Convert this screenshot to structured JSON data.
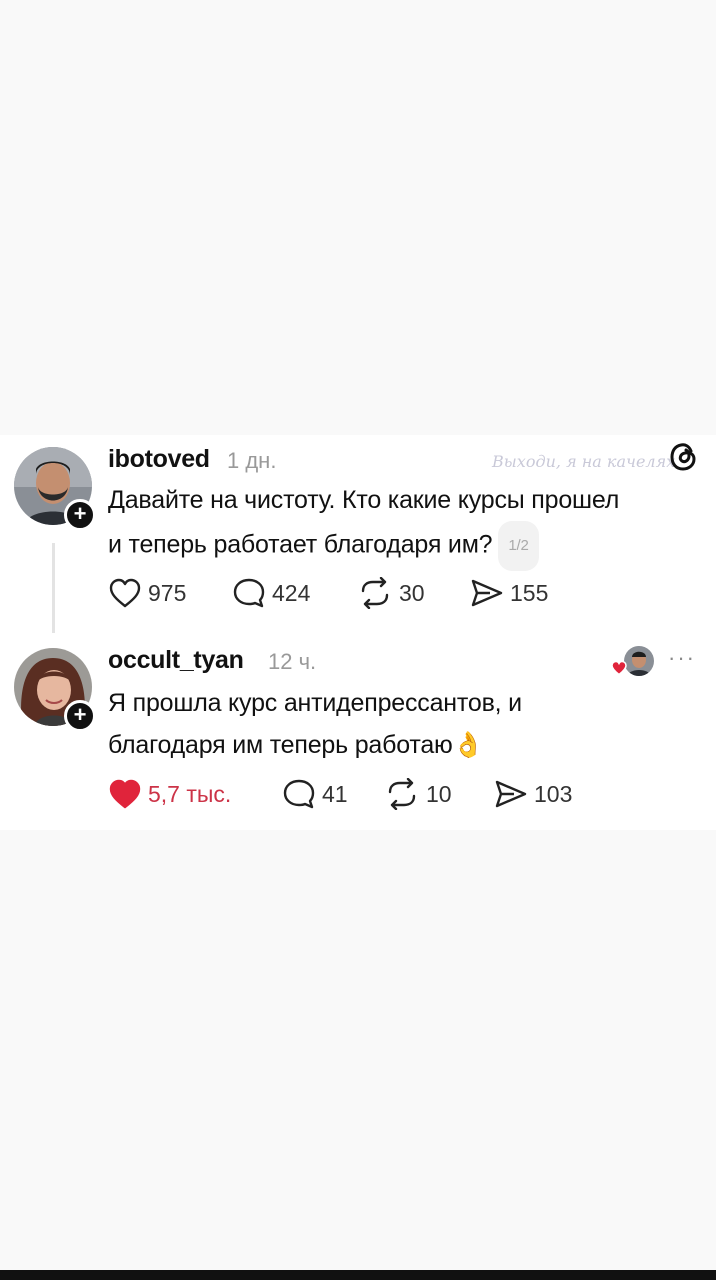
{
  "watermark": "Выходи, я на качелях",
  "posts": [
    {
      "username": "ibotoved",
      "time": "1 дн.",
      "text_line1": "Давайте на чистоту. Кто какие курсы прошел",
      "text_line2": "и теперь работает благодаря им?",
      "pager": "1/2",
      "likes": "975",
      "comments": "424",
      "reposts": "30",
      "shares": "155",
      "liked": false
    },
    {
      "username": "occult_tyan",
      "time": "12 ч.",
      "text_line1": "Я прошла курс антидепрессантов, и",
      "text_line2": "благодаря им теперь работаю",
      "emoji": "👌",
      "likes": "5,7 тыс.",
      "comments": "41",
      "reposts": "10",
      "shares": "103",
      "liked": true
    }
  ],
  "more_menu": "···",
  "plus_badge": "+",
  "colors": {
    "like": "#e0243b",
    "background": "#f9f9f9",
    "card": "#ffffff"
  },
  "icons": [
    "threads-logo-icon",
    "heart-icon",
    "comment-icon",
    "repost-icon",
    "share-icon",
    "more-icon",
    "plus-icon"
  ]
}
